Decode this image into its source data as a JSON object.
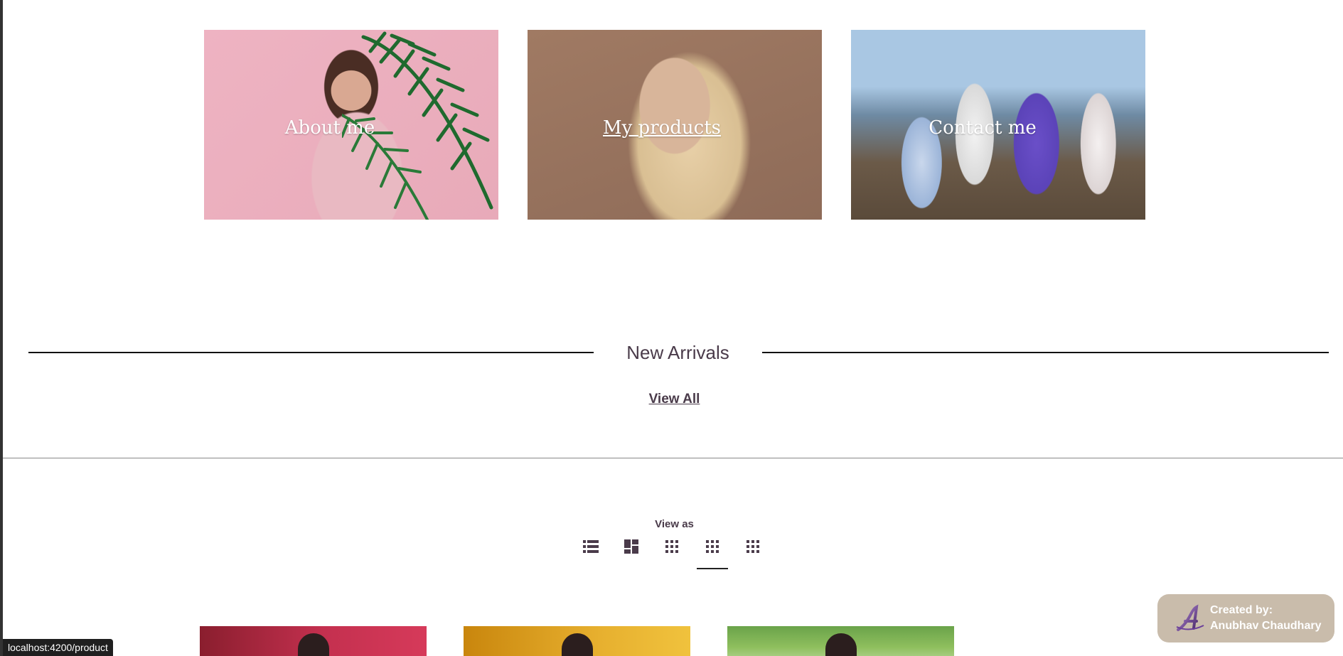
{
  "cards": [
    {
      "label": "About me"
    },
    {
      "label": "My products"
    },
    {
      "label": "Contact me"
    }
  ],
  "arrivals": {
    "title": "New Arrivals",
    "view_all": "View All"
  },
  "view_as": {
    "label": "View as",
    "options": [
      {
        "icon": "list-view-icon"
      },
      {
        "icon": "masonry-view-icon"
      },
      {
        "icon": "grid-3-icon"
      },
      {
        "icon": "grid-4-icon",
        "active": true
      },
      {
        "icon": "grid-5-icon"
      }
    ]
  },
  "status_bar": {
    "url": "localhost:4200/product"
  },
  "credit": {
    "line1": "Created by:",
    "line2": "Anubhav Chaudhary"
  },
  "colors": {
    "text": "#4a3b4a",
    "credit_bg": "#c9bcab"
  }
}
